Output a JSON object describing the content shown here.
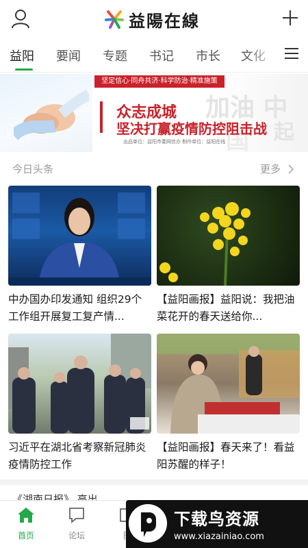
{
  "app": {
    "logo_text": "益陽在線"
  },
  "tabs": {
    "items": [
      "益阳",
      "要闻",
      "专题",
      "书记",
      "市长",
      "文化"
    ],
    "active_index": 0
  },
  "banner": {
    "top_strip": "坚定信心·同舟共济·科学防治·精准施策",
    "title_line1": "众志成城",
    "title_line2": "坚决打赢疫情防控阻击战",
    "credit": "出品单位：益阳市委网信办 制作单位：益阳在线",
    "bg_text1": "加油 中",
    "bg_text2": "起",
    "bg_text3": "国"
  },
  "section": {
    "title": "今日头条",
    "more": "更多"
  },
  "cards": [
    {
      "title": "中办国办印发通知 组织29个工作组开展复工复产情..."
    },
    {
      "title": "【益阳画报】益阳说：我把油菜花开的春天送给你..."
    },
    {
      "title": "习近平在湖北省考察新冠肺炎疫情防控工作"
    },
    {
      "title": "【益阳画报】春天来了！看益阳苏醒的样子！"
    }
  ],
  "peek": {
    "text": "《湖南日报》 亮出"
  },
  "bottom_nav": {
    "items": [
      {
        "label": "首页",
        "icon": "home-icon"
      },
      {
        "label": "论坛",
        "icon": "chat-icon"
      },
      {
        "label": "图",
        "icon": "image-icon"
      }
    ],
    "active_index": 0
  },
  "watermark": {
    "title": "下载鸟资源",
    "url": "www.xiazainiao.com"
  },
  "colors": {
    "accent": "#24a94a",
    "banner_red": "#c9222b"
  }
}
